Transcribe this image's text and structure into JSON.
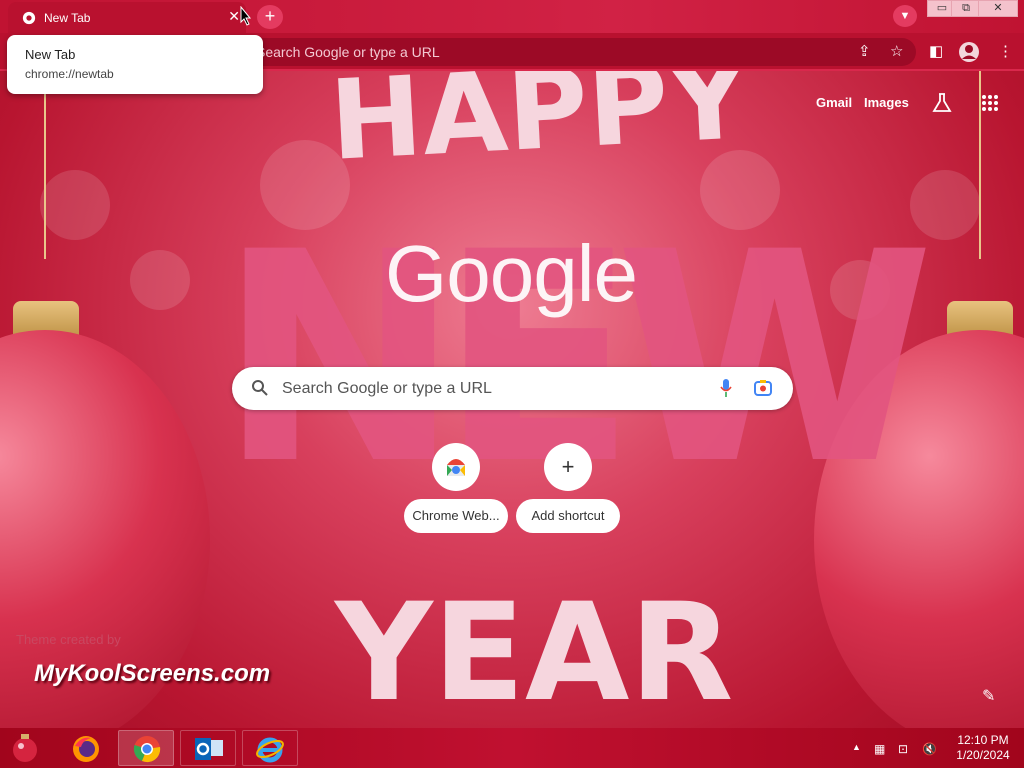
{
  "tab": {
    "title": "New Tab",
    "close": "✕"
  },
  "tooltip": {
    "title": "New Tab",
    "url": "chrome://newtab"
  },
  "omnibox": {
    "placeholder": "Search Google or type a URL"
  },
  "window_controls": {
    "minimize": "▭",
    "restore": "⧉",
    "close": "✕"
  },
  "header_links": {
    "gmail": "Gmail",
    "images": "Images"
  },
  "logo": "Google",
  "search": {
    "placeholder": "Search Google or type a URL"
  },
  "shortcuts": [
    {
      "label": "Chrome Web...",
      "icon": "chrome-web-store-icon"
    },
    {
      "label": "Add shortcut",
      "icon": "plus-icon",
      "symbol": "+"
    }
  ],
  "theme_credit": "Theme created by",
  "watermark": "MyKoolScreens.com",
  "background_art": {
    "top": "HAPPY",
    "middle": "NEW",
    "bottom": "YEAR"
  },
  "taskbar": {
    "apps": [
      "firefox-icon",
      "chrome-icon",
      "outlook-icon",
      "internet-explorer-icon"
    ],
    "clock_time": "12:10 PM",
    "clock_date": "1/20/2024"
  },
  "colors": {
    "accent": "#b9112f",
    "tab_bar": "#c01332",
    "text": "#ffffff"
  }
}
